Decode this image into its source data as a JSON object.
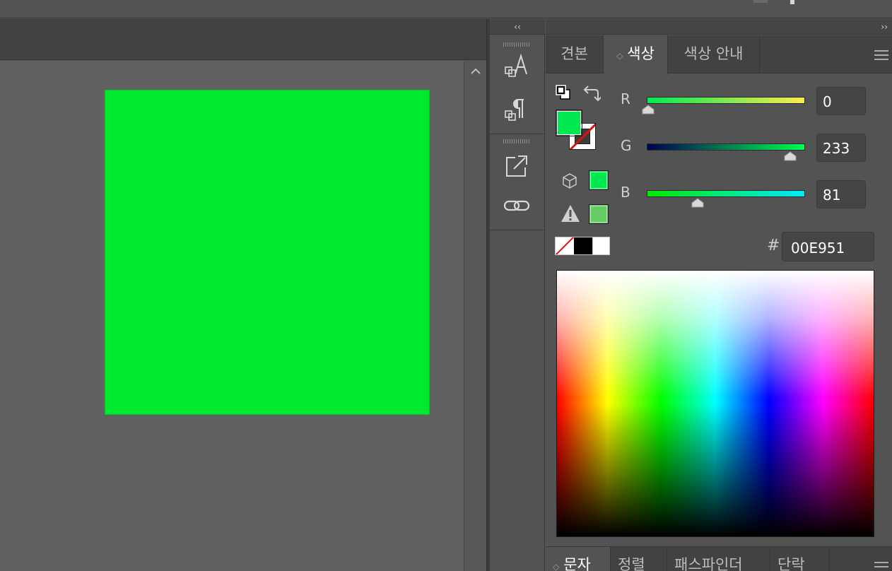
{
  "window": {
    "dock_collapse_label": "‹‹",
    "panel_expand_label": "››"
  },
  "artboard": {
    "shape_fill": "#00E92F",
    "canvas_bg": "#616161"
  },
  "dock_icons": [
    "character-styles-icon",
    "paragraph-styles-icon",
    "export-icon",
    "links-icon"
  ],
  "color_tabs": [
    {
      "label": "견본",
      "active": false
    },
    {
      "label": "색상",
      "active": true
    },
    {
      "label": "색상 안내",
      "active": false
    }
  ],
  "color": {
    "fill_color": "#00E951",
    "stroke": "none",
    "sliders": [
      {
        "label": "R",
        "value": "0",
        "level": 0,
        "gradient": [
          "#00e951",
          "#ffe951"
        ]
      },
      {
        "label": "G",
        "value": "233",
        "level": 0.914,
        "gradient": [
          "#000051",
          "#00ff51"
        ]
      },
      {
        "label": "B",
        "value": "81",
        "level": 0.318,
        "gradient": [
          "#00e900",
          "#00e9ff"
        ]
      }
    ],
    "hash_label": "#",
    "hex_value": "00E951",
    "out_of_gamut_swatch": "#00E951",
    "web_safe_swatch": "#66CC66"
  },
  "bottom_tabs": [
    {
      "label": "문자",
      "active": true
    },
    {
      "label": "정렬",
      "active": false
    },
    {
      "label": "패스파인더",
      "active": false
    },
    {
      "label": "단락",
      "active": false
    }
  ]
}
